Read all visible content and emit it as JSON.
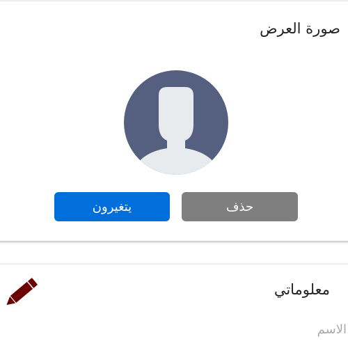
{
  "profile_photo_card": {
    "title": "صورة العرض",
    "avatar_icon": "default-user-silhouette-icon",
    "change_button_label": "يتغيرون",
    "delete_button_label": "حذف"
  },
  "info_card": {
    "title": "معلوماتي",
    "edit_icon": "pencil-icon",
    "first_field_label": "الاسم"
  },
  "colors": {
    "primary": "#006fdc",
    "secondary": "#7f7f7f",
    "avatar_bg": "#555f7f",
    "avatar_silhouette": "#e7ebee",
    "edit_icon": "#6b0000"
  }
}
